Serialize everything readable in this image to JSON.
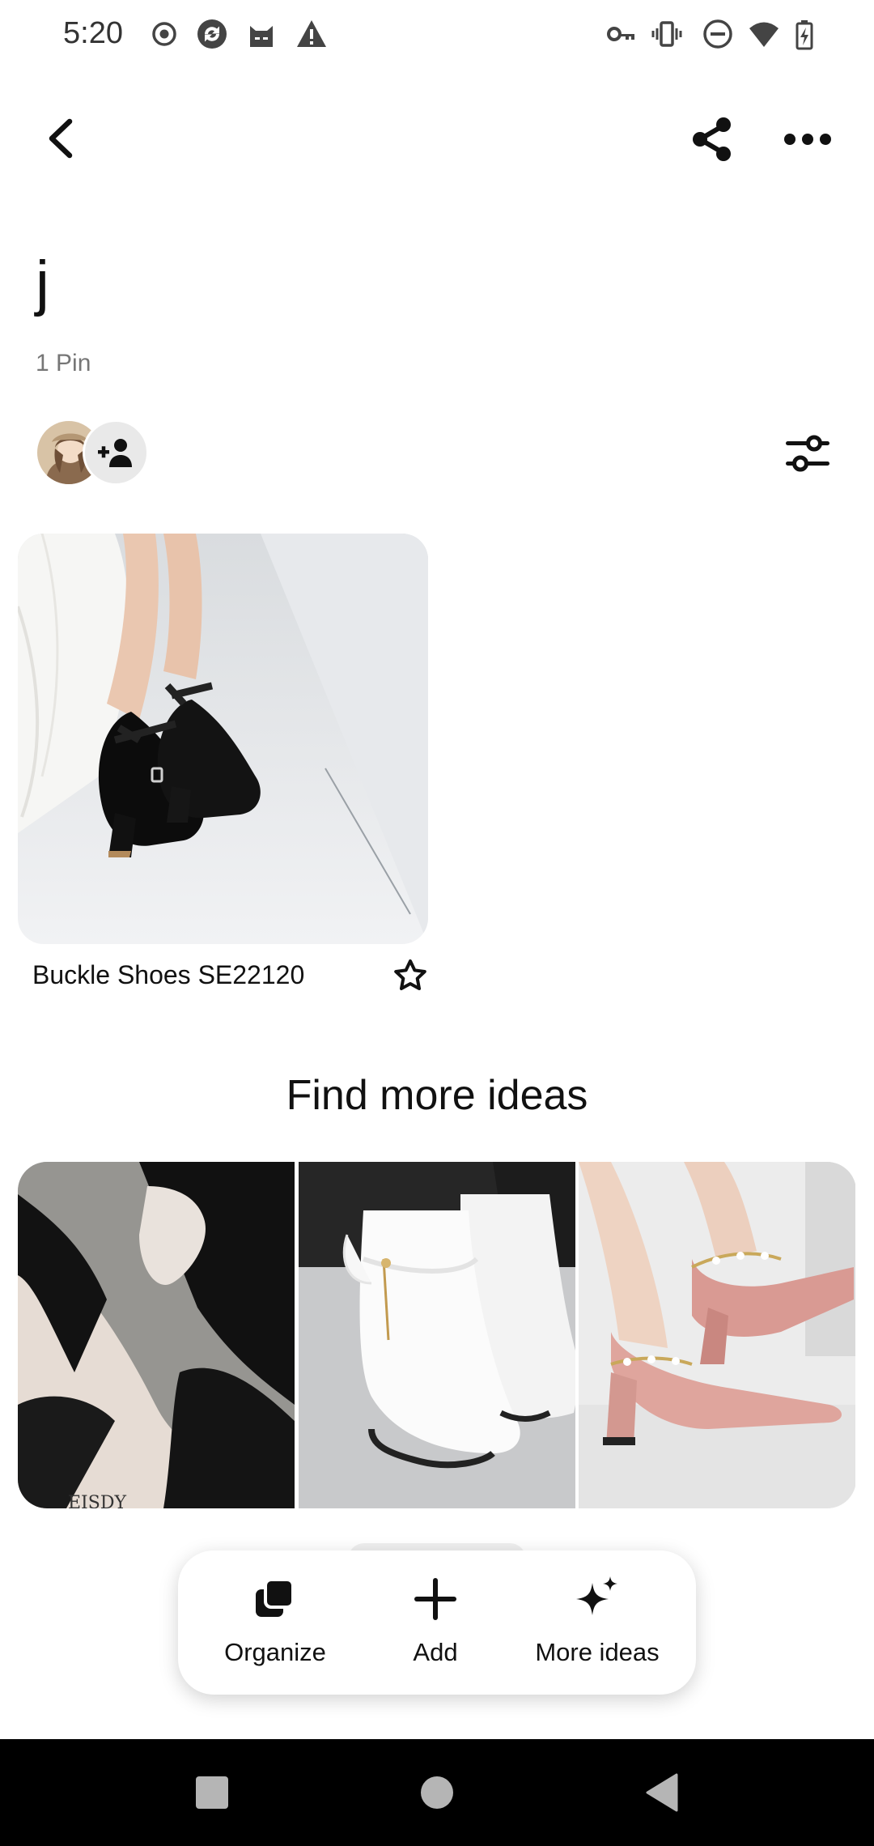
{
  "status_bar": {
    "time": "5:20",
    "left_icons": [
      "record-icon",
      "sync-app-icon",
      "cat-app-icon",
      "warning-icon"
    ],
    "right_icons": [
      "vpn-key-icon",
      "vibrate-icon",
      "do-not-disturb-icon",
      "wifi-icon",
      "battery-charging-icon"
    ]
  },
  "top_bar": {
    "back_icon": "chevron-left-icon",
    "share_icon": "share-icon",
    "more_icon": "more-horizontal-icon"
  },
  "board": {
    "title": "j",
    "pin_count": "1 Pin",
    "add_collaborator_icon": "person-add-icon",
    "filter_icon": "sliders-icon"
  },
  "pins": [
    {
      "title": "Buckle Shoes SE22120",
      "image": "black suede ankle-strap block-heel shoes",
      "favorite_icon": "star-outline-icon"
    }
  ],
  "find_more": {
    "title": "Find more ideas",
    "images": [
      "black knit flat shoes",
      "white ankle boots",
      "pink block-heel ankle-strap pumps"
    ]
  },
  "toolbar": {
    "items": [
      {
        "label": "Organize",
        "icon": "stack-icon"
      },
      {
        "label": "Add",
        "icon": "plus-icon"
      },
      {
        "label": "More ideas",
        "icon": "sparkle-icon"
      }
    ]
  },
  "nav_bar": {
    "icons": [
      "recents-square-icon",
      "home-circle-icon",
      "back-triangle-icon"
    ]
  },
  "colors": {
    "background": "#ffffff",
    "text": "#111111",
    "muted_text": "#767676",
    "nav_bar": "#000000"
  }
}
